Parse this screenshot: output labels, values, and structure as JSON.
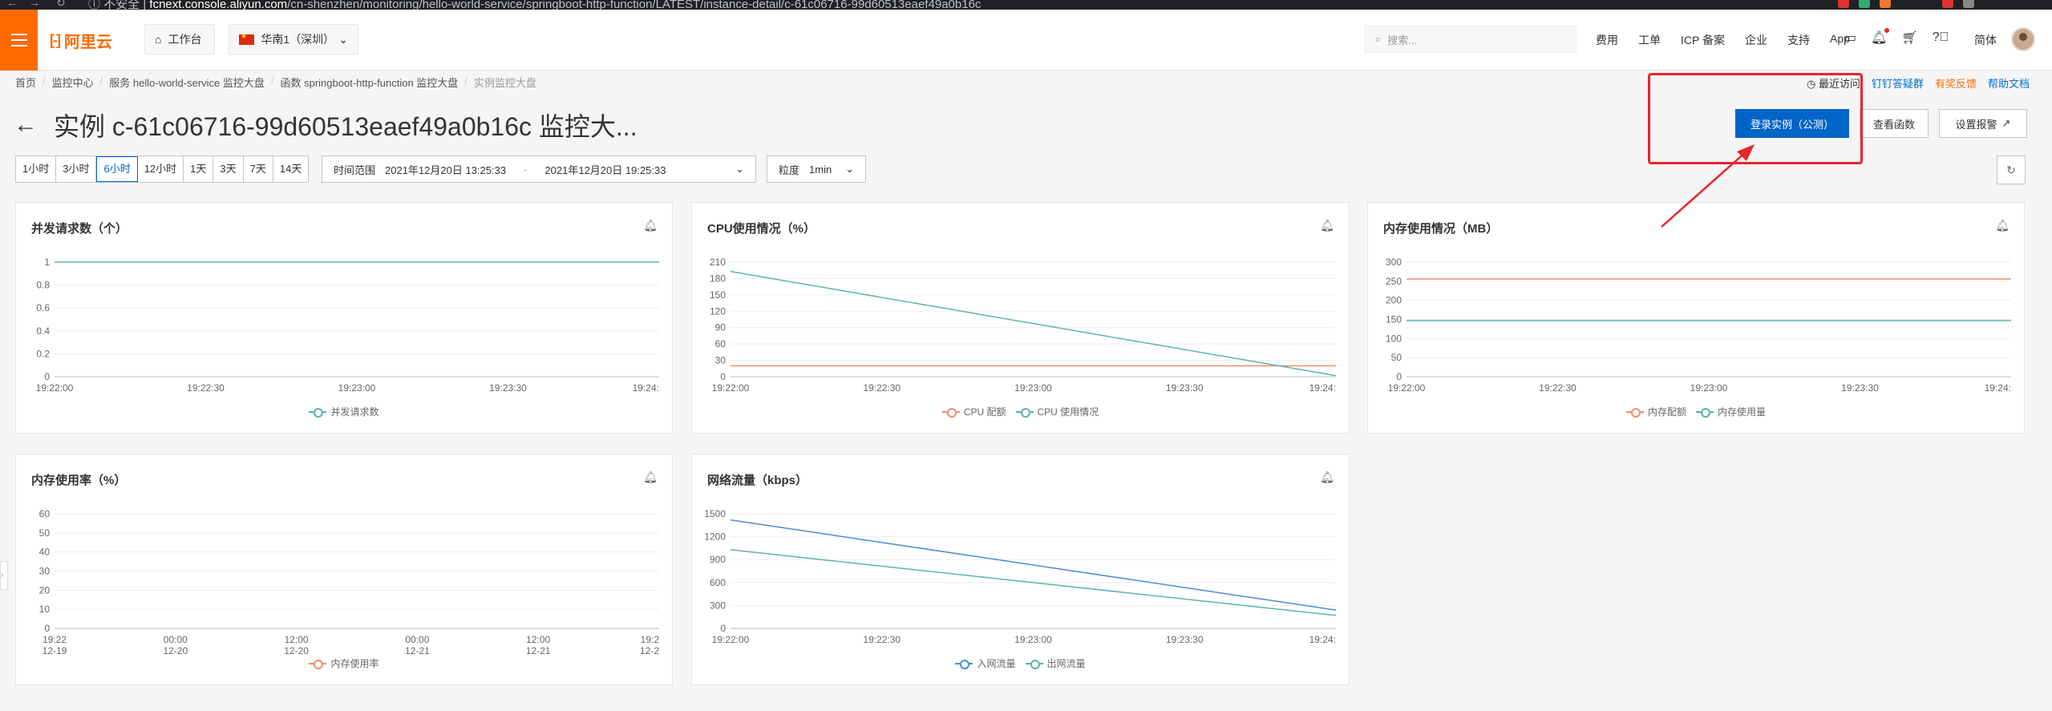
{
  "browser": {
    "security": "不安全",
    "domain": "fcnext.console.aliyun.com",
    "path": "/cn-shenzhen/monitoring/hello-world-service/springboot-http-function/LATEST/instance-detail/c-61c06716-99d60513eaef49a0b16c"
  },
  "topnav": {
    "logo_text": "阿里云",
    "workbench": "工作台",
    "region": "华南1（深圳）",
    "search_placeholder": "搜索...",
    "links": [
      "费用",
      "工单",
      "ICP 备案",
      "企业",
      "支持",
      "App"
    ],
    "lang": "简体"
  },
  "breadcrumb": [
    "首页",
    "监控中心",
    "服务 hello-world-service 监控大盘",
    "函数 springboot-http-function 监控大盘",
    "实例监控大盘"
  ],
  "header": {
    "title": "实例 c-61c06716-99d60513eaef49a0b16c 监控大...",
    "recent": "最近访问",
    "dingtalk": "钉钉答疑群",
    "feedback": "有奖反馈",
    "help": "帮助文档",
    "login_btn": "登录实例（公测）",
    "view_func_btn": "查看函数",
    "alarm_btn": "设置报警"
  },
  "filters": {
    "ranges": [
      "1小时",
      "3小时",
      "6小时",
      "12小时",
      "1天",
      "3天",
      "7天",
      "14天"
    ],
    "active_range": "6小时",
    "time_label": "时间范围",
    "start": "2021年12月20日 13:25:33",
    "dash": "-",
    "end": "2021年12月20日 19:25:33",
    "granularity_label": "粒度",
    "granularity": "1min"
  },
  "colors": {
    "accent": "#ff6a00",
    "primary": "#0064c8",
    "teal": "#5ab4ac",
    "salmon": "#f08c6c",
    "blue": "#4a8ed1",
    "annotation": "#e8262c"
  },
  "chart_data": [
    {
      "id": "concurrency",
      "title": "并发请求数（个）",
      "type": "line",
      "x": [
        "19:22:00",
        "19:22:30",
        "19:23:00",
        "19:23:30",
        "19:24:"
      ],
      "ylim": [
        0,
        1
      ],
      "yticks": [
        "1",
        "0.8",
        "0.6",
        "0.4",
        "0.2",
        "0"
      ],
      "series": [
        {
          "name": "并发请求数",
          "color": "#5ab4ac",
          "values": [
            1,
            1
          ]
        }
      ]
    },
    {
      "id": "cpu",
      "title": "CPU使用情况（%）",
      "type": "line",
      "x": [
        "19:22:00",
        "19:22:30",
        "19:23:00",
        "19:23:30",
        "19:24:"
      ],
      "ylim": [
        0,
        210
      ],
      "yticks": [
        "210",
        "180",
        "150",
        "120",
        "90",
        "60",
        "30",
        "0"
      ],
      "series": [
        {
          "name": "CPU 配额",
          "color": "#f08c6c",
          "values": [
            20,
            20
          ]
        },
        {
          "name": "CPU 使用情况",
          "color": "#5ab4ac",
          "values": [
            193,
            2
          ]
        }
      ]
    },
    {
      "id": "memory",
      "title": "内存使用情况（MB）",
      "type": "line",
      "x": [
        "19:22:00",
        "19:22:30",
        "19:23:00",
        "19:23:30",
        "19:24:"
      ],
      "ylim": [
        0,
        300
      ],
      "yticks": [
        "300",
        "250",
        "200",
        "150",
        "100",
        "50",
        "0"
      ],
      "series": [
        {
          "name": "内存配额",
          "color": "#f08c6c",
          "values": [
            256,
            256
          ]
        },
        {
          "name": "内存使用量",
          "color": "#5ab4ac",
          "values": [
            147,
            147
          ]
        }
      ]
    },
    {
      "id": "mem_rate",
      "title": "内存使用率（%）",
      "type": "line",
      "x": [
        "19:22\n12-19",
        "00:00\n12-20",
        "12:00\n12-20",
        "00:00\n12-21",
        "12:00\n12-21",
        "19:2\n12-2"
      ],
      "ylim": [
        0,
        60
      ],
      "yticks": [
        "60",
        "50",
        "40",
        "30",
        "20",
        "10",
        "0"
      ],
      "series": [
        {
          "name": "内存使用率",
          "color": "#f08c6c",
          "values": []
        }
      ]
    },
    {
      "id": "network",
      "title": "网络流量（kbps）",
      "type": "line",
      "x": [
        "19:22:00",
        "19:22:30",
        "19:23:00",
        "19:23:30",
        "19:24:"
      ],
      "ylim": [
        0,
        1500
      ],
      "yticks": [
        "1500",
        "1200",
        "900",
        "600",
        "300",
        "0"
      ],
      "series": [
        {
          "name": "入网流量",
          "color": "#4a8ed1",
          "values": [
            1420,
            240
          ]
        },
        {
          "name": "出网流量",
          "color": "#5ab4ac",
          "values": [
            1030,
            170
          ]
        }
      ]
    }
  ]
}
